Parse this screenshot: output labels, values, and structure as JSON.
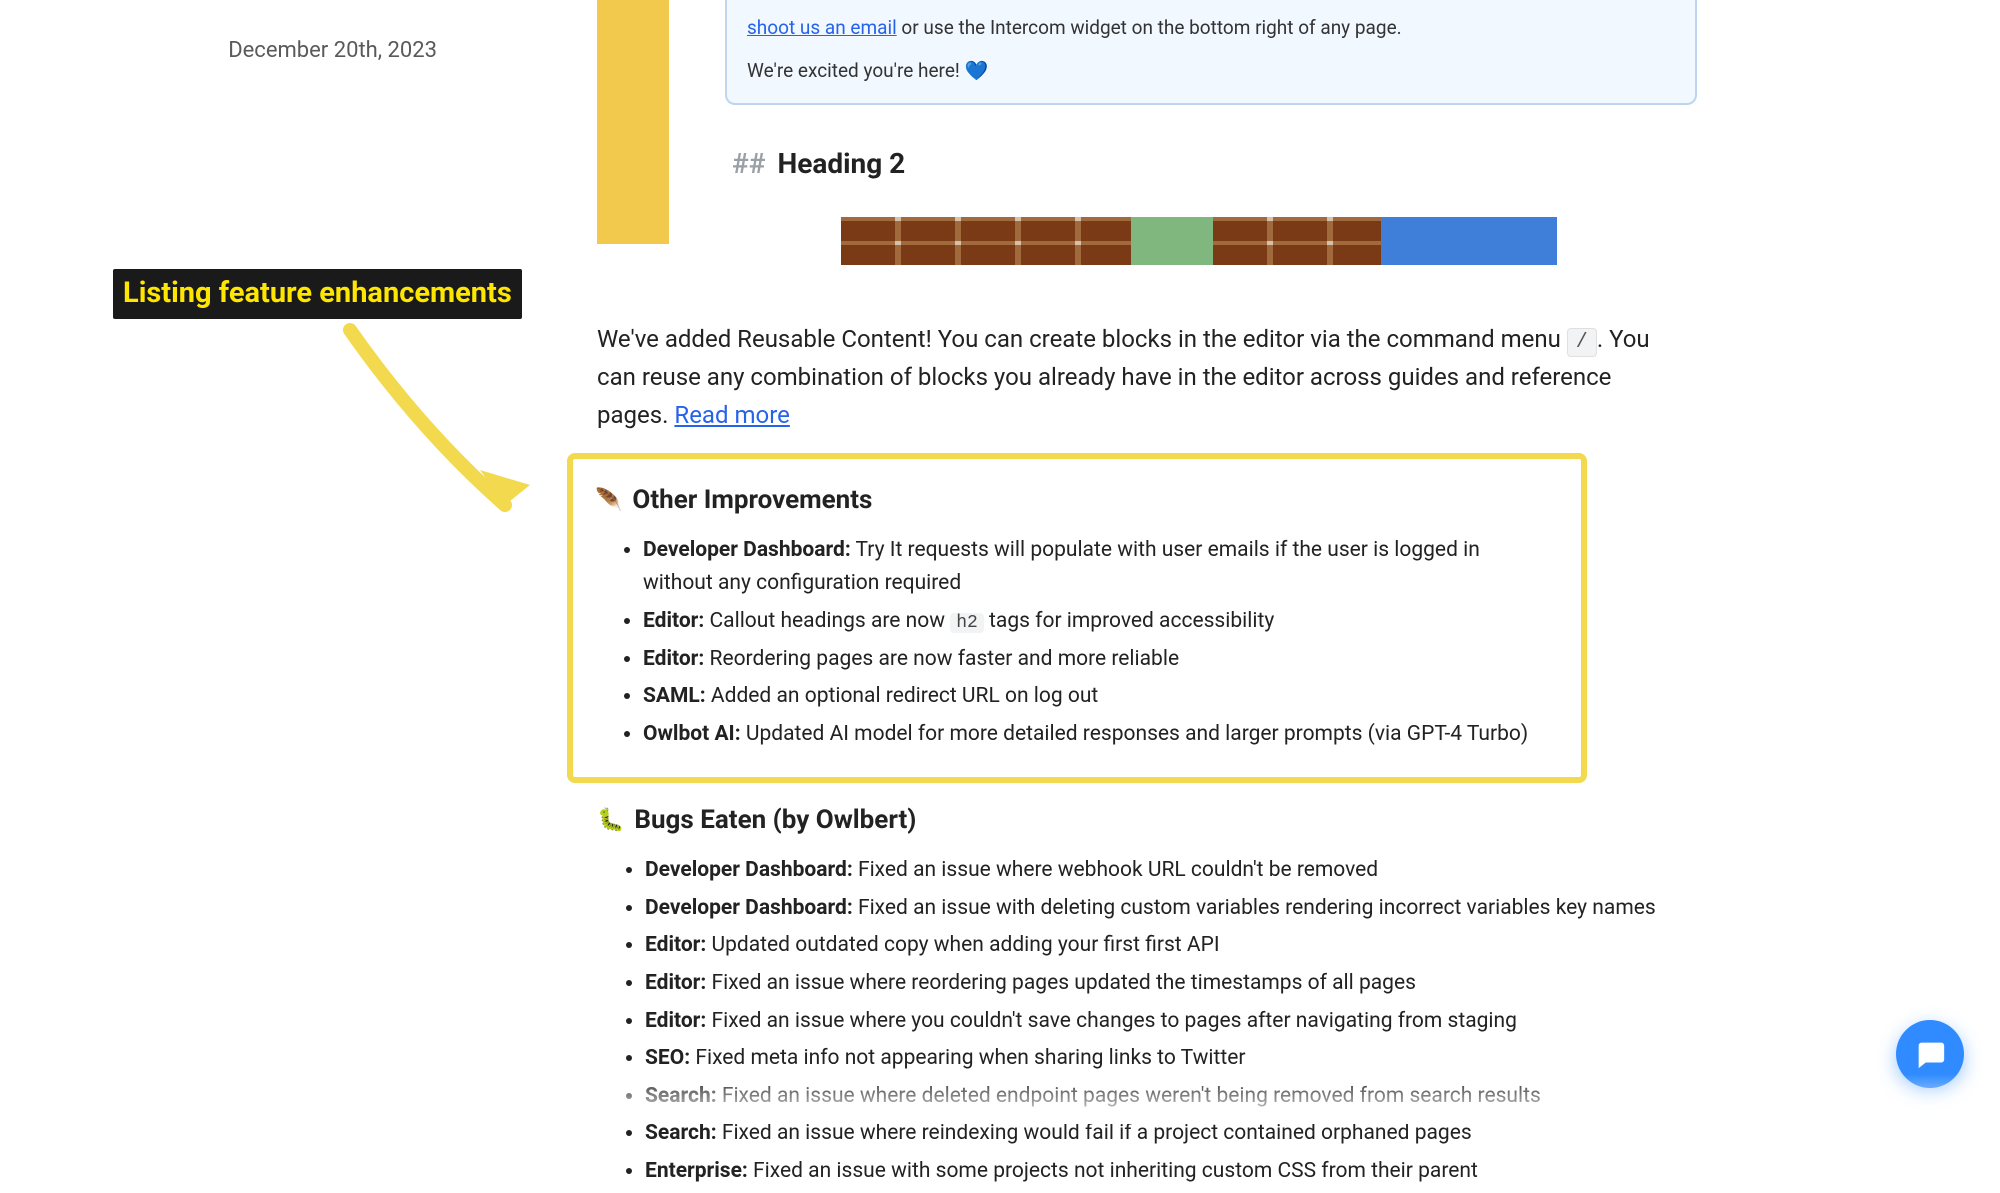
{
  "sidebar": {
    "date": "December 20th, 2023"
  },
  "annotation": {
    "label": "Listing feature enhancements"
  },
  "preview": {
    "email_link": "shoot us an email",
    "email_after": " or use the Intercom widget on the bottom right of any page.",
    "excited": "We're excited you're here! ",
    "heart": "💙",
    "hash": "##",
    "heading2": "Heading 2"
  },
  "intro": {
    "text_before_kbd": "We've added Reusable Content! You can create blocks in the editor via the command menu ",
    "kbd": "/",
    "text_after_kbd": ". You can reuse any combination of blocks you already have in the editor across guides and reference pages. ",
    "read_more": "Read more"
  },
  "improvements": {
    "icon": "🪶",
    "heading": "Other Improvements",
    "items": [
      {
        "label": "Developer Dashboard:",
        "text": " Try It requests will populate with user emails if the user is logged in without any configuration required"
      },
      {
        "label": "Editor:",
        "text_before_code": " Callout headings are now ",
        "code": "h2",
        "text_after_code": " tags for improved accessibility"
      },
      {
        "label": "Editor:",
        "text": " Reordering pages are now faster and more reliable"
      },
      {
        "label": "SAML:",
        "text": " Added an optional redirect URL on log out"
      },
      {
        "label": "Owlbot AI:",
        "text": " Updated AI model for more detailed responses and larger prompts (via GPT-4 Turbo)"
      }
    ]
  },
  "bugs": {
    "icon": "🐛",
    "heading": "Bugs Eaten (by Owlbert)",
    "items": [
      {
        "label": "Developer Dashboard:",
        "text": " Fixed an issue where webhook URL couldn't be removed"
      },
      {
        "label": "Developer Dashboard:",
        "text": " Fixed an issue with deleting custom variables rendering incorrect variables key names"
      },
      {
        "label": "Editor:",
        "text": " Updated outdated copy when adding your first first API"
      },
      {
        "label": "Editor:",
        "text": " Fixed an issue where reordering pages updated the timestamps of all pages"
      },
      {
        "label": "Editor:",
        "text": " Fixed an issue where you couldn't save changes to pages after navigating from staging"
      },
      {
        "label": "SEO:",
        "text": " Fixed meta info not appearing when sharing links to Twitter"
      },
      {
        "label": "Search:",
        "text": " Fixed an issue where deleted endpoint pages weren't being removed from search results"
      },
      {
        "label": "Search:",
        "text": " Fixed an issue where reindexing would fail if a project contained orphaned pages"
      },
      {
        "label": "Enterprise:",
        "text": " Fixed an issue with some projects not inheriting custom CSS from their parent"
      }
    ]
  }
}
